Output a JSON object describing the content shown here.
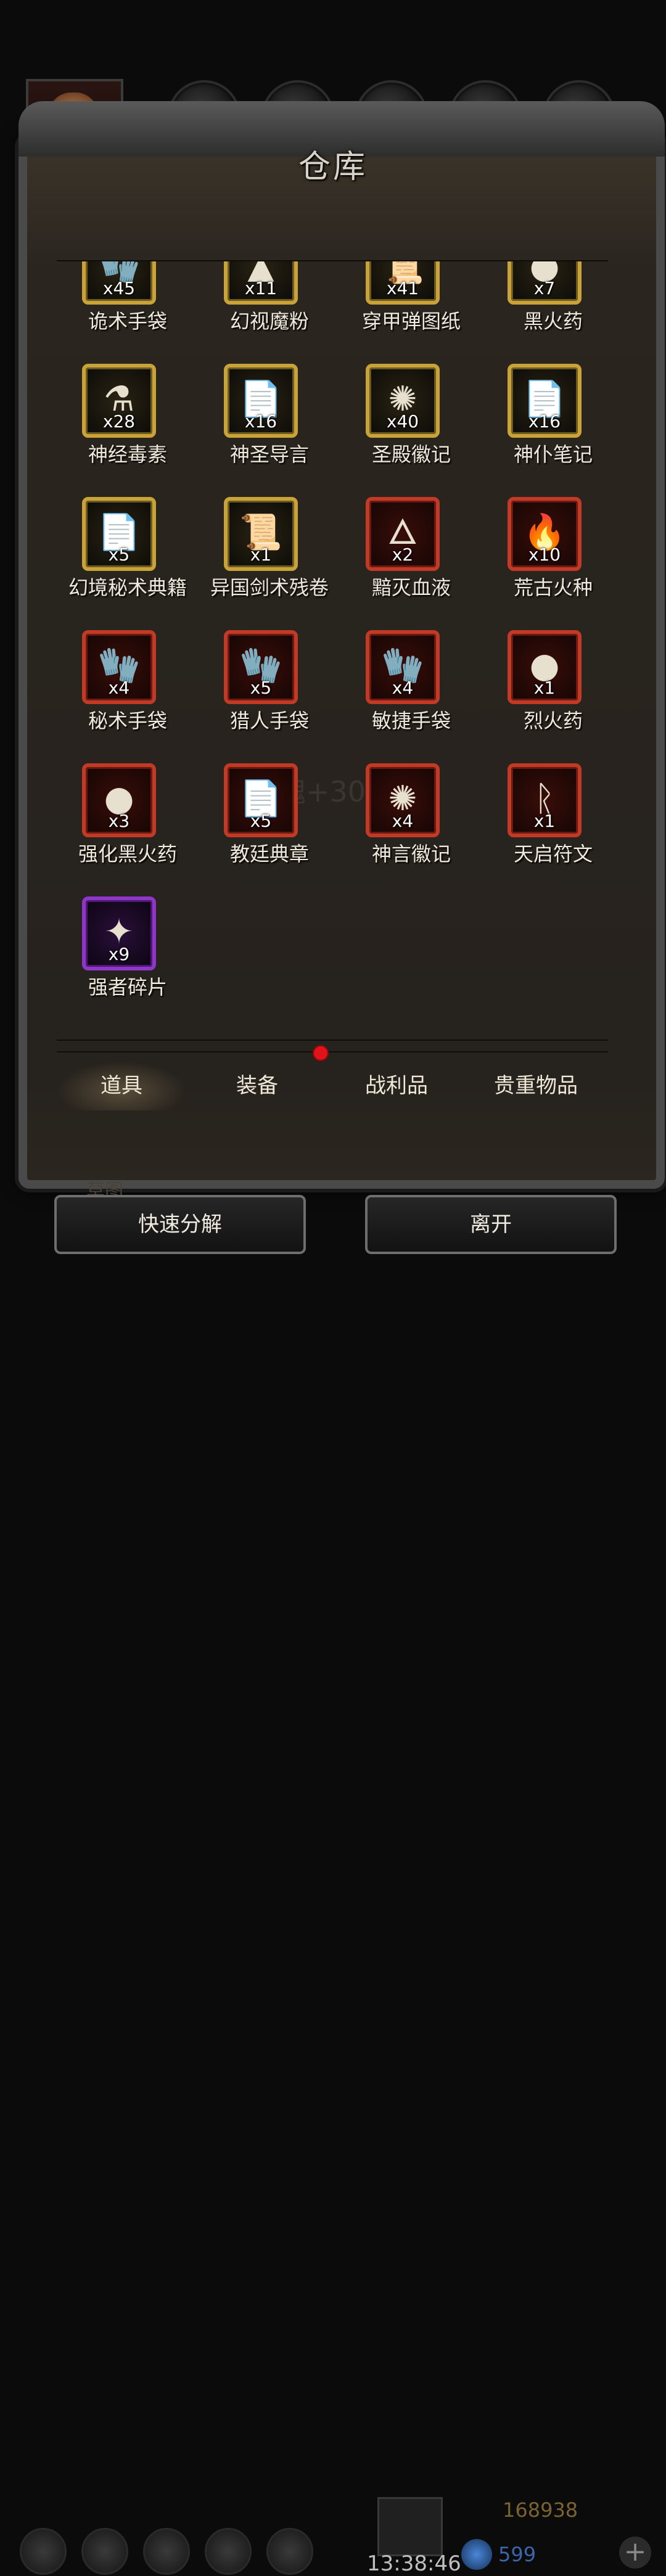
{
  "window": {
    "title": "仓库"
  },
  "tabs": [
    {
      "label": "道具",
      "active": true
    },
    {
      "label": "装备",
      "badge": true
    },
    {
      "label": "战利品"
    },
    {
      "label": "贵重物品"
    }
  ],
  "items": [
    {
      "name": "诡术手袋",
      "qty": "x45",
      "rarity": "gold",
      "icon": "glove-icon"
    },
    {
      "name": "幻视魔粉",
      "qty": "x11",
      "rarity": "gold",
      "icon": "powder-icon"
    },
    {
      "name": "穿甲弹图纸",
      "qty": "x41",
      "rarity": "gold",
      "icon": "scroll-icon"
    },
    {
      "name": "黑火药",
      "qty": "x7",
      "rarity": "gold",
      "icon": "gunpowder-icon"
    },
    {
      "name": "神经毒素",
      "qty": "x28",
      "rarity": "gold",
      "icon": "toxin-icon"
    },
    {
      "name": "神圣导言",
      "qty": "x16",
      "rarity": "gold",
      "icon": "parchment-icon"
    },
    {
      "name": "圣殿徽记",
      "qty": "x40",
      "rarity": "gold",
      "icon": "emblem-icon"
    },
    {
      "name": "神仆笔记",
      "qty": "x16",
      "rarity": "gold",
      "icon": "parchment-icon"
    },
    {
      "name": "幻境秘术典籍",
      "qty": "x5",
      "rarity": "gold",
      "icon": "parchment-icon"
    },
    {
      "name": "异国剑术残卷",
      "qty": "x1",
      "rarity": "gold",
      "icon": "rolled-scroll-icon"
    },
    {
      "name": "黯灭血液",
      "qty": "x2",
      "rarity": "red",
      "icon": "blue-flame-icon"
    },
    {
      "name": "荒古火种",
      "qty": "x10",
      "rarity": "red",
      "icon": "fire-icon"
    },
    {
      "name": "秘术手袋",
      "qty": "x4",
      "rarity": "red",
      "icon": "glove-icon"
    },
    {
      "name": "猎人手袋",
      "qty": "x5",
      "rarity": "red",
      "icon": "glove-icon"
    },
    {
      "name": "敏捷手袋",
      "qty": "x4",
      "rarity": "red",
      "icon": "glove-icon"
    },
    {
      "name": "烈火药",
      "qty": "x1",
      "rarity": "red",
      "icon": "gunpowder-icon"
    },
    {
      "name": "强化黑火药",
      "qty": "x3",
      "rarity": "red",
      "icon": "gunpowder-icon"
    },
    {
      "name": "教廷典章",
      "qty": "x5",
      "rarity": "red",
      "icon": "parchment-icon"
    },
    {
      "name": "神言徽记",
      "qty": "x4",
      "rarity": "red",
      "icon": "emblem-icon"
    },
    {
      "name": "天启符文",
      "qty": "x1",
      "rarity": "red",
      "icon": "rune-icon"
    },
    {
      "name": "强者碎片",
      "qty": "x9",
      "rarity": "purple",
      "icon": "shard-icon"
    }
  ],
  "watermark": "魂+300",
  "buttons": {
    "decompose": "快速分解",
    "leave": "离开"
  },
  "hud": {
    "timer": "13:38:46",
    "gold": "168938",
    "gems": "599",
    "faded_label": "草图"
  },
  "colors": {
    "gold_frame": "#c9a338",
    "red_frame": "#c23a25",
    "purple_frame": "#8f35c9"
  }
}
